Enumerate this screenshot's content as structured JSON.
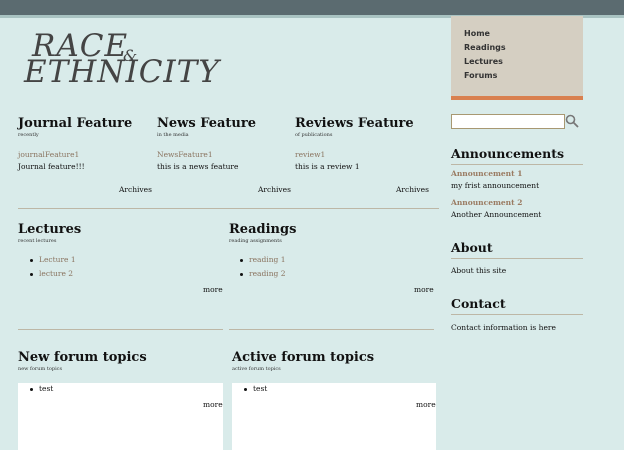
{
  "logo": {
    "line1": "RACE",
    "amp": "&",
    "line2": "ETHNICITY"
  },
  "nav": [
    "Home",
    "Readings",
    "Lectures",
    "Forums"
  ],
  "search": {
    "placeholder": ""
  },
  "features": [
    {
      "title": "Journal Feature",
      "sub": "recently",
      "link": "journalFeature1",
      "text": "Journal feature!!!",
      "archives": "Archives"
    },
    {
      "title": "News Feature",
      "sub": "in the media",
      "link": "NewsFeature1",
      "text": "this is a news feature",
      "archives": "Archives"
    },
    {
      "title": "Reviews Feature",
      "sub": "of publications",
      "link": "review1",
      "text": "this is a review 1",
      "archives": "Archives"
    }
  ],
  "lectures": {
    "title": "Lectures",
    "sub": "recent lectures",
    "items": [
      "Lecture 1",
      "lecture 2"
    ],
    "more": "more"
  },
  "readings": {
    "title": "Readings",
    "sub": "reading assignments",
    "items": [
      "reading 1",
      "reading 2"
    ],
    "more": "more"
  },
  "new_forum": {
    "title": "New forum topics",
    "sub": "new forum topics",
    "items": [
      "test"
    ],
    "more": "more"
  },
  "active_forum": {
    "title": "Active forum topics",
    "sub": "active forum topics",
    "items": [
      "test"
    ],
    "more": "more"
  },
  "announcements": {
    "title": "Announcements",
    "items": [
      {
        "title": "Announcement 1",
        "text": "my frist announcement"
      },
      {
        "title": "Announcement 2",
        "text": "Another Announcement"
      }
    ]
  },
  "about": {
    "title": "About",
    "text": "About this site"
  },
  "contact": {
    "title": "Contact",
    "text": "Contact information is here"
  }
}
